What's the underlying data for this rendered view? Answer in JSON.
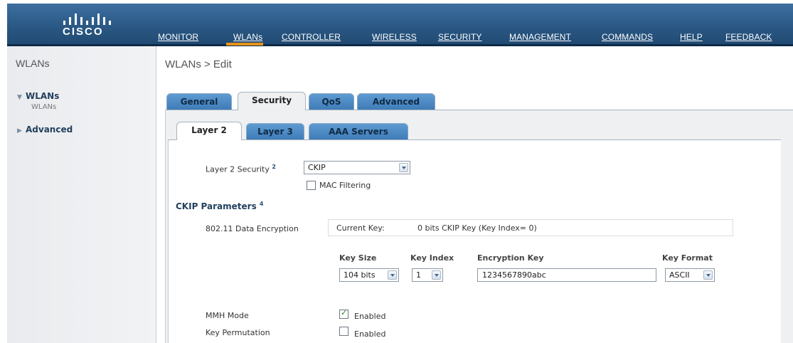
{
  "brand": {
    "logo_text": "CISCO"
  },
  "nav": {
    "items": [
      {
        "key": "M",
        "label": "MONITOR"
      },
      {
        "key": "W",
        "label": "WLANs"
      },
      {
        "key": "C",
        "label": "CONTROLLER"
      },
      {
        "key": "I",
        "label": "WIRELESS"
      },
      {
        "key": "S",
        "label": "SECURITY"
      },
      {
        "key": "A",
        "label": "MANAGEMENT"
      },
      {
        "key": "O",
        "label": "COMMANDS"
      },
      {
        "key": "L",
        "label": "HELP"
      },
      {
        "key": "F",
        "label": "FEEDBACK"
      }
    ],
    "active": "WLANs"
  },
  "sidebar": {
    "title": "WLANs",
    "items": [
      {
        "label": "WLANs",
        "expanded": true,
        "sub": [
          "WLANs"
        ]
      },
      {
        "label": "Advanced",
        "expanded": false
      }
    ]
  },
  "page": {
    "title": "WLANs > Edit"
  },
  "tabs": [
    {
      "label": "General"
    },
    {
      "label": "Security"
    },
    {
      "label": "QoS"
    },
    {
      "label": "Advanced"
    }
  ],
  "subtabs": [
    {
      "label": "Layer 2"
    },
    {
      "label": "Layer 3"
    },
    {
      "label": "AAA Servers"
    }
  ],
  "layer2": {
    "security_label": "Layer 2 Security",
    "security_note": "2",
    "security_value": "CKIP",
    "mac_filtering_label": "MAC Filtering",
    "mac_filtering_checked": false
  },
  "ckip": {
    "section_title": "CKIP Parameters",
    "section_note": "4",
    "data_encryption_label": "802.11 Data Encryption",
    "current_key_label": "Current Key:",
    "current_key_value": "0 bits CKIP Key (Key Index= 0)",
    "columns": [
      "Key Size",
      "Key Index",
      "Encryption Key",
      "Key Format"
    ],
    "key_size": "104 bits",
    "key_index": "1",
    "encryption_key": "1234567890abc",
    "key_format": "ASCII",
    "mmh_mode_label": "MMH Mode",
    "mmh_enabled_label": "Enabled",
    "mmh_enabled": true,
    "key_permutation_label": "Key Permutation",
    "key_permutation_enabled_label": "Enabled",
    "key_permutation_enabled": false
  },
  "colors": {
    "header": "#2a5884",
    "tab_blue": "#4a88c2",
    "nav_active": "#e8941a",
    "section": "#23405e"
  },
  "icons": [
    "cisco-logo-bars",
    "triangle-down-icon",
    "triangle-right-icon",
    "chevron-down-icon",
    "checkbox-checked-icon"
  ]
}
